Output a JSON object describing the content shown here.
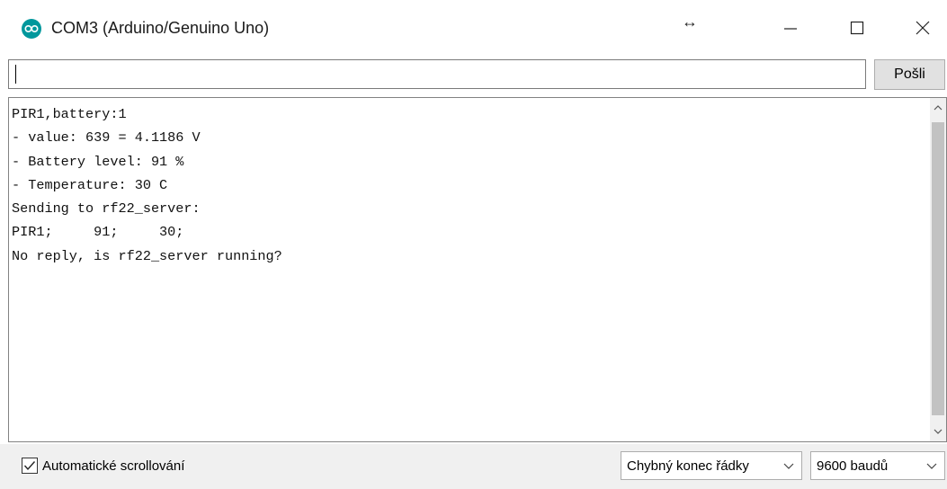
{
  "window": {
    "title": "COM3 (Arduino/Genuino Uno)",
    "icon": "arduino-logo-icon",
    "resize_glyph": "↔",
    "controls": [
      "minimize-icon",
      "maximize-icon",
      "close-icon"
    ]
  },
  "send": {
    "input_value": "",
    "button_label": "Pošli"
  },
  "output": {
    "lines": [
      "PIR1,battery:1",
      "- value: 639 = 4.1186 V",
      "- Battery level: 91 %",
      "- Temperature: 30 C",
      "Sending to rf22_server:",
      "PIR1;     91;     30;",
      "No reply, is rf22_server running?"
    ]
  },
  "status": {
    "autoscroll_label": "Automatické scrollování",
    "autoscroll_checked": true,
    "line_ending": "Chybný konec řádky",
    "baud_rate": "9600 baudů"
  },
  "colors": {
    "accent": "#00979c",
    "status_bar": "#f0f0f0",
    "button": "#e1e1e1"
  }
}
